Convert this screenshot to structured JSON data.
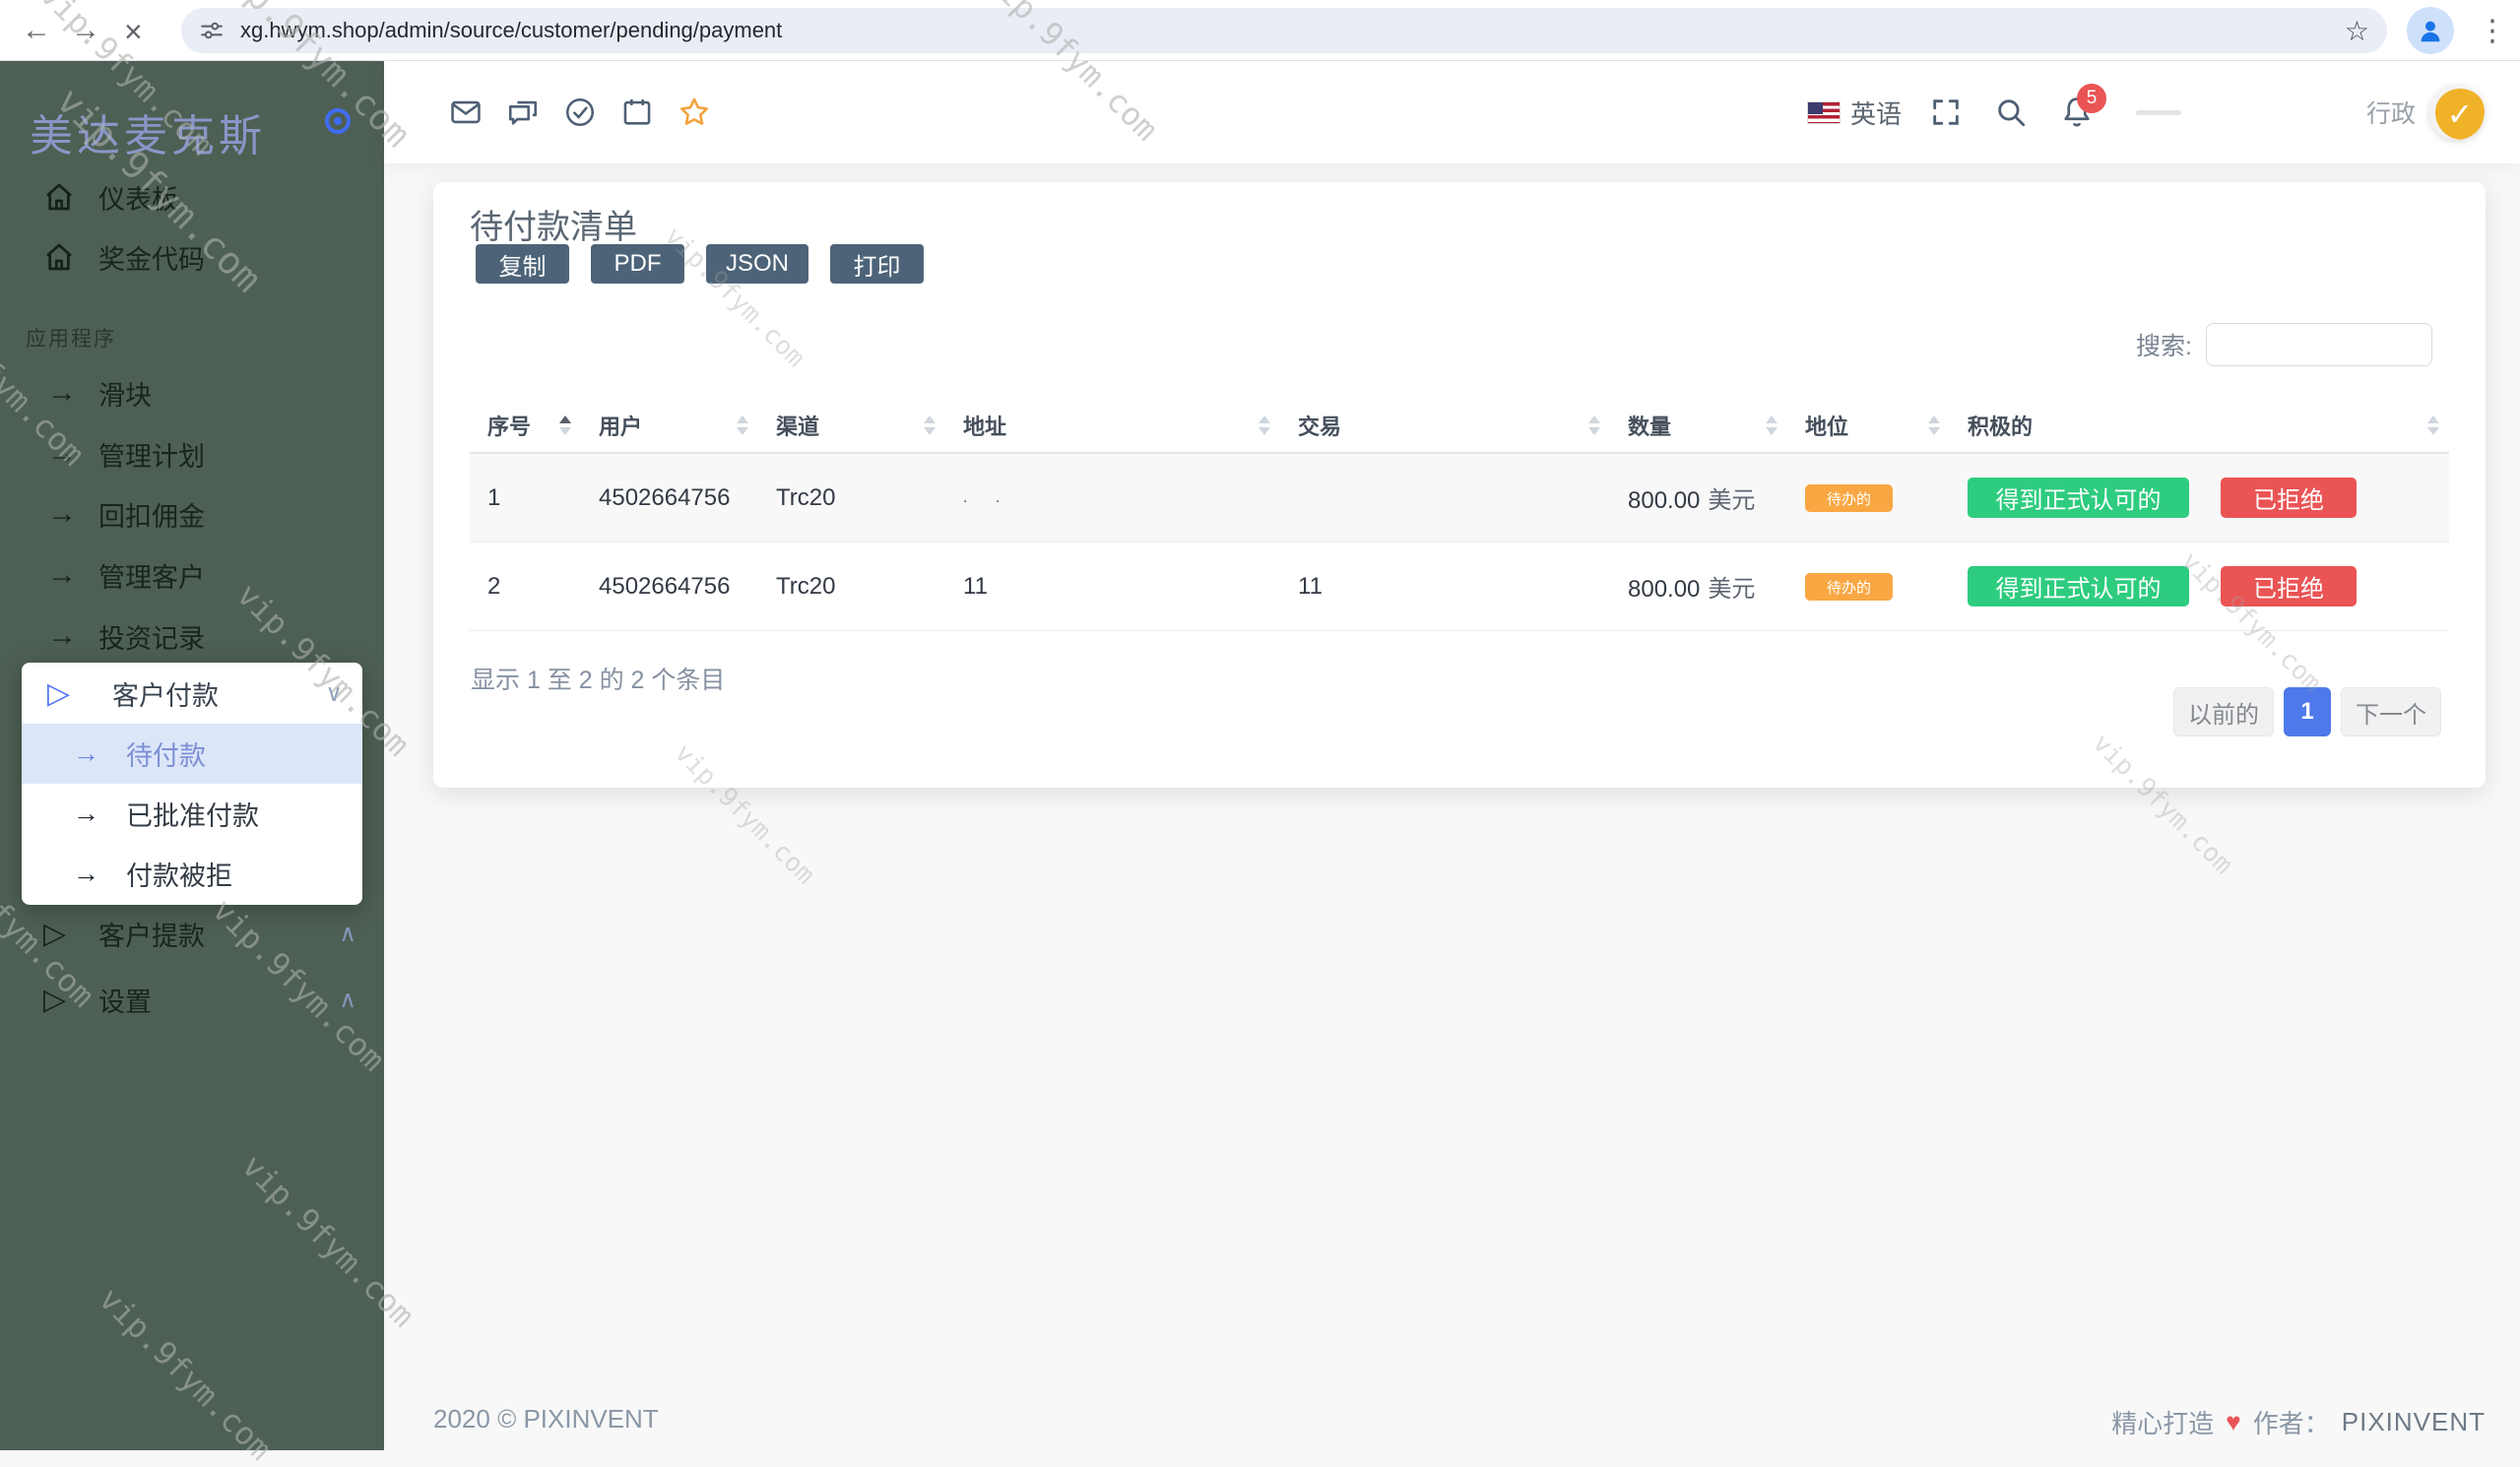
{
  "browser": {
    "url": "xg.hwym.shop/admin/source/customer/pending/payment"
  },
  "watermark": {
    "text": "vip.9fym.com"
  },
  "colors": {
    "sidebar_bg": "#4e5f53",
    "accent_blue": "#4e79ea",
    "success_green": "#2ecc7f",
    "danger_red": "#ea5455",
    "warning_badge_orange": "#f9a743",
    "star_amber": "#f2a23c"
  },
  "sidebar": {
    "logo": "美达麦克斯",
    "top_items": [
      {
        "label": "仪表板"
      },
      {
        "label": "奖金代码"
      }
    ],
    "section_title": "应用程序",
    "app_items": [
      {
        "label": "滑块"
      },
      {
        "label": "管理计划"
      },
      {
        "label": "回扣佣金"
      },
      {
        "label": "管理客户"
      },
      {
        "label": "投资记录"
      }
    ],
    "submenu": {
      "title": "客户付款",
      "items": [
        {
          "label": "待付款"
        },
        {
          "label": "已批准付款"
        },
        {
          "label": "付款被拒"
        }
      ]
    },
    "collapsed_items": [
      {
        "label": "客户提款"
      },
      {
        "label": "设置"
      }
    ]
  },
  "header": {
    "language": "英语",
    "notification_count": "5",
    "user_role": "行政"
  },
  "page": {
    "title": "待付款清单",
    "export_buttons": [
      {
        "label": "复制"
      },
      {
        "label": "PDF"
      },
      {
        "label": "JSON"
      },
      {
        "label": "打印"
      }
    ],
    "search_label": "搜索:"
  },
  "table": {
    "columns": [
      "序号",
      "用户",
      "渠道",
      "地址",
      "交易",
      "数量",
      "地位",
      "积极的"
    ],
    "rows": [
      {
        "no": "1",
        "user": "4502664756",
        "channel": "Trc20",
        "address": ". .",
        "transaction": "",
        "amount": "800.00",
        "currency": "美元",
        "status": "待办的",
        "approve_label": "得到正式认可的",
        "reject_label": "已拒绝"
      },
      {
        "no": "2",
        "user": "4502664756",
        "channel": "Trc20",
        "address": "11",
        "transaction": "11",
        "amount": "800.00",
        "currency": "美元",
        "status": "待办的",
        "approve_label": "得到正式认可的",
        "reject_label": "已拒绝"
      }
    ],
    "summary": "显示 1 至 2 的 2 个条目",
    "pagination": {
      "prev": "以前的",
      "current": "1",
      "next": "下一个"
    }
  },
  "footer": {
    "copyright": "2020 © PIXINVENT",
    "made_with": "精心打造",
    "heart": "♥",
    "author_label": "作者：",
    "author": "PIXINVENT"
  }
}
